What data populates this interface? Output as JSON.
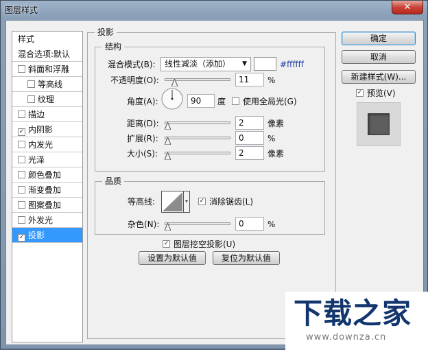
{
  "window": {
    "title": "图层样式",
    "close_glyph": "✕"
  },
  "sidebar": {
    "items": [
      {
        "label": "样式",
        "checkbox": false,
        "checked": false,
        "indent": false,
        "selected": false
      },
      {
        "label": "混合选项:默认",
        "checkbox": false,
        "checked": false,
        "indent": false,
        "selected": false
      },
      {
        "label": "斜面和浮雕",
        "checkbox": true,
        "checked": false,
        "indent": false,
        "selected": false
      },
      {
        "label": "等高线",
        "checkbox": true,
        "checked": false,
        "indent": true,
        "selected": false
      },
      {
        "label": "纹理",
        "checkbox": true,
        "checked": false,
        "indent": true,
        "selected": false
      },
      {
        "label": "描边",
        "checkbox": true,
        "checked": false,
        "indent": false,
        "selected": false
      },
      {
        "label": "内阴影",
        "checkbox": true,
        "checked": true,
        "indent": false,
        "selected": false
      },
      {
        "label": "内发光",
        "checkbox": true,
        "checked": false,
        "indent": false,
        "selected": false
      },
      {
        "label": "光泽",
        "checkbox": true,
        "checked": false,
        "indent": false,
        "selected": false
      },
      {
        "label": "颜色叠加",
        "checkbox": true,
        "checked": false,
        "indent": false,
        "selected": false
      },
      {
        "label": "渐变叠加",
        "checkbox": true,
        "checked": false,
        "indent": false,
        "selected": false
      },
      {
        "label": "图案叠加",
        "checkbox": true,
        "checked": false,
        "indent": false,
        "selected": false
      },
      {
        "label": "外发光",
        "checkbox": true,
        "checked": false,
        "indent": false,
        "selected": false
      },
      {
        "label": "投影",
        "checkbox": true,
        "checked": true,
        "indent": false,
        "selected": true
      }
    ]
  },
  "panel": {
    "title": "投影",
    "structure": {
      "title": "结构",
      "blend_mode_label": "混合模式(B):",
      "blend_mode_value": "线性减淡（添加）",
      "color_hex": "#ffffff",
      "opacity_label": "不透明度(O):",
      "opacity_value": "11",
      "opacity_fraction": 0.11,
      "percent": "%",
      "angle_label": "角度(A):",
      "angle_value": "90",
      "angle_unit": "度",
      "global_light_label": "使用全局光(G)",
      "global_light_checked": false,
      "distance_label": "距离(D):",
      "distance_value": "2",
      "px_unit": "像素",
      "spread_label": "扩展(R):",
      "spread_value": "0",
      "spread_fraction": 0,
      "size_label": "大小(S):",
      "size_value": "2",
      "size_unit": "像素"
    },
    "quality": {
      "title": "品质",
      "contour_label": "等高线:",
      "anti_alias_label": "消除锯齿(L)",
      "anti_alias_checked": true,
      "noise_label": "杂色(N):",
      "noise_value": "0",
      "noise_fraction": 0,
      "percent": "%"
    },
    "knockout_label": "图层挖空投影(U)",
    "knockout_checked": true,
    "set_default_label": "设置为默认值",
    "reset_default_label": "复位为默认值"
  },
  "buttons": {
    "ok": "确定",
    "cancel": "取消",
    "new_style": "新建样式(W)...",
    "preview_label": "预览(V)",
    "preview_checked": true
  },
  "watermark": {
    "logo": "下载之家",
    "url": "www.downza.cn"
  },
  "colors": {
    "selection": "#3399ff",
    "hex_text": "#1f3ea8",
    "watermark": "#12356e"
  }
}
